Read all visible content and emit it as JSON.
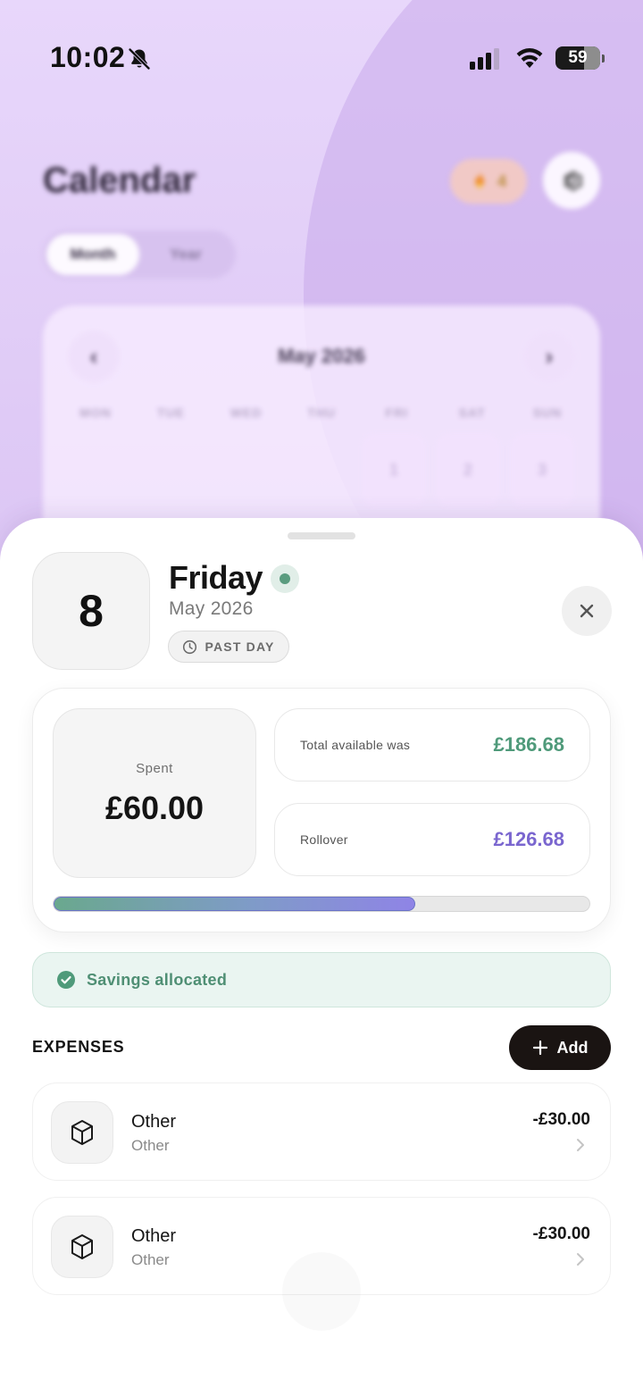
{
  "status_bar": {
    "time": "10:02",
    "battery": "59"
  },
  "background_app": {
    "title": "Calendar",
    "streak_count": "4",
    "view_toggle": [
      "Month",
      "Year"
    ],
    "calendar": {
      "month_label": "May 2026",
      "prev_label": "‹",
      "next_label": "›",
      "weekdays": [
        "MON",
        "TUE",
        "WED",
        "THU",
        "FRI",
        "SAT",
        "SUN"
      ],
      "days": [
        "1",
        "2",
        "3"
      ]
    }
  },
  "sheet": {
    "date_number": "8",
    "day_name": "Friday",
    "month_year": "May 2026",
    "past_label": "PAST DAY",
    "summary": {
      "spent_label": "Spent",
      "spent_value": "£60.00",
      "total_label": "Total available was",
      "total_value": "£186.68",
      "rollover_label": "Rollover",
      "rollover_value": "£126.68",
      "progress_fraction": 0.675
    },
    "savings_text": "Savings allocated",
    "expenses_title": "EXPENSES",
    "add_label": "Add",
    "expenses": [
      {
        "name": "Other",
        "category": "Other",
        "amount": "-£30.00"
      },
      {
        "name": "Other",
        "category": "Other",
        "amount": "-£30.00"
      }
    ]
  },
  "colors": {
    "accent_green": "#4f9a7a",
    "accent_purple": "#7a66cf",
    "background_lavender": "#dcc6f4"
  }
}
